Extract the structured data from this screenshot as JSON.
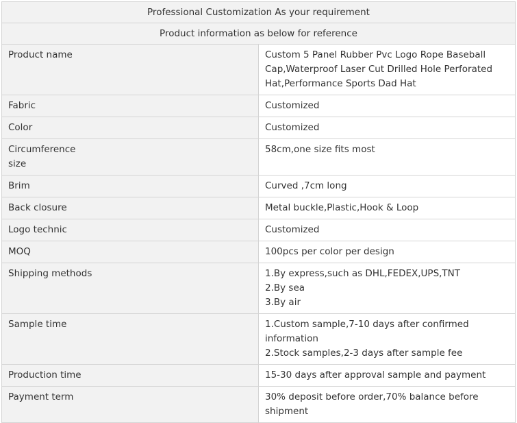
{
  "header": {
    "title": "Professional Customization As your requirement",
    "subtitle": "Product information as below for reference"
  },
  "rows": [
    {
      "label": [
        "Product name"
      ],
      "value": [
        "Custom 5 Panel Rubber Pvc Logo Rope Baseball Cap,Waterproof Laser Cut Drilled Hole Perforated Hat,Performance Sports Dad Hat"
      ]
    },
    {
      "label": [
        "Fabric"
      ],
      "value": [
        "Customized"
      ]
    },
    {
      "label": [
        "Color"
      ],
      "value": [
        "Customized"
      ]
    },
    {
      "label": [
        "Circumference",
        "size"
      ],
      "value": [
        "58cm,one size fits most"
      ]
    },
    {
      "label": [
        "Brim"
      ],
      "value": [
        "Curved ,7cm long"
      ]
    },
    {
      "label": [
        "Back closure"
      ],
      "value": [
        "Metal buckle,Plastic,Hook & Loop"
      ]
    },
    {
      "label": [
        "Logo technic"
      ],
      "value": [
        "Customized"
      ]
    },
    {
      "label": [
        "MOQ"
      ],
      "value": [
        "100pcs per color per design"
      ]
    },
    {
      "label": [
        "Shipping methods"
      ],
      "value": [
        "1.By express,such as DHL,FEDEX,UPS,TNT",
        "2.By sea",
        "3.By air"
      ]
    },
    {
      "label": [
        "Sample time"
      ],
      "value": [
        "1.Custom sample,7-10 days after confirmed information",
        "2.Stock samples,2-3 days after sample fee"
      ]
    },
    {
      "label": [
        "Production time"
      ],
      "value": [
        "15-30 days after approval sample and payment"
      ]
    },
    {
      "label": [
        "Payment term"
      ],
      "value": [
        "30% deposit before order,70% balance before shipment"
      ]
    }
  ]
}
